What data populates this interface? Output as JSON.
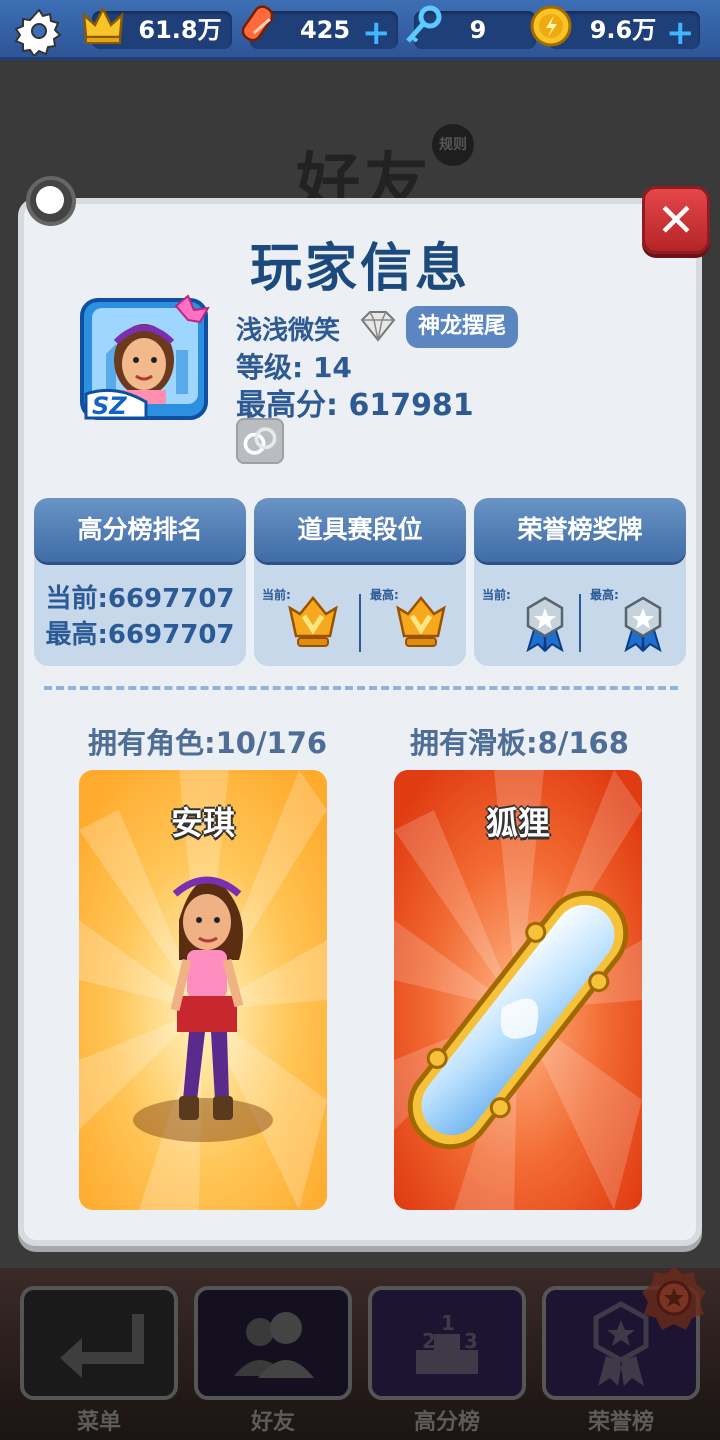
{
  "topbar": {
    "settings_icon": "gear-icon",
    "resources": [
      {
        "icon": "crown-icon",
        "value": "61.8万",
        "has_plus": false
      },
      {
        "icon": "hoverboard-icon",
        "value": "425",
        "has_plus": true
      },
      {
        "icon": "key-icon",
        "value": "9",
        "has_plus": false
      },
      {
        "icon": "coin-icon",
        "value": "9.6万",
        "has_plus": true
      }
    ]
  },
  "background": {
    "title": "好友",
    "rules_badge": "规则"
  },
  "dialog": {
    "title": "玩家信息",
    "close_icon": "close-icon",
    "player": {
      "name": "浅浅微笑",
      "title_tag": "神龙摆尾",
      "level_label": "等级: 14",
      "highscore_label": "最高分: 617981",
      "avatar_badge": "SZ"
    },
    "cards": [
      {
        "header": "高分榜排名",
        "current": "当前:6697707",
        "best": "最高:6697707"
      },
      {
        "header": "道具赛段位",
        "current_label": "当前:",
        "best_label": "最高:"
      },
      {
        "header": "荣誉榜奖牌",
        "current_label": "当前:",
        "best_label": "最高:"
      }
    ],
    "owned_characters": "拥有角色:10/176",
    "owned_boards": "拥有滑板:8/168",
    "character_name": "安琪",
    "board_name": "狐狸"
  },
  "bottom_nav": [
    {
      "label": "菜单",
      "icon": "return-icon"
    },
    {
      "label": "好友",
      "icon": "friends-icon"
    },
    {
      "label": "高分榜",
      "icon": "podium-icon"
    },
    {
      "label": "荣誉榜",
      "icon": "medal-icon"
    }
  ],
  "colors": {
    "accent_blue": "#2d5a92",
    "close_red": "#c8302f",
    "character_bg": "#ffb43c",
    "board_bg": "#e8441a"
  }
}
